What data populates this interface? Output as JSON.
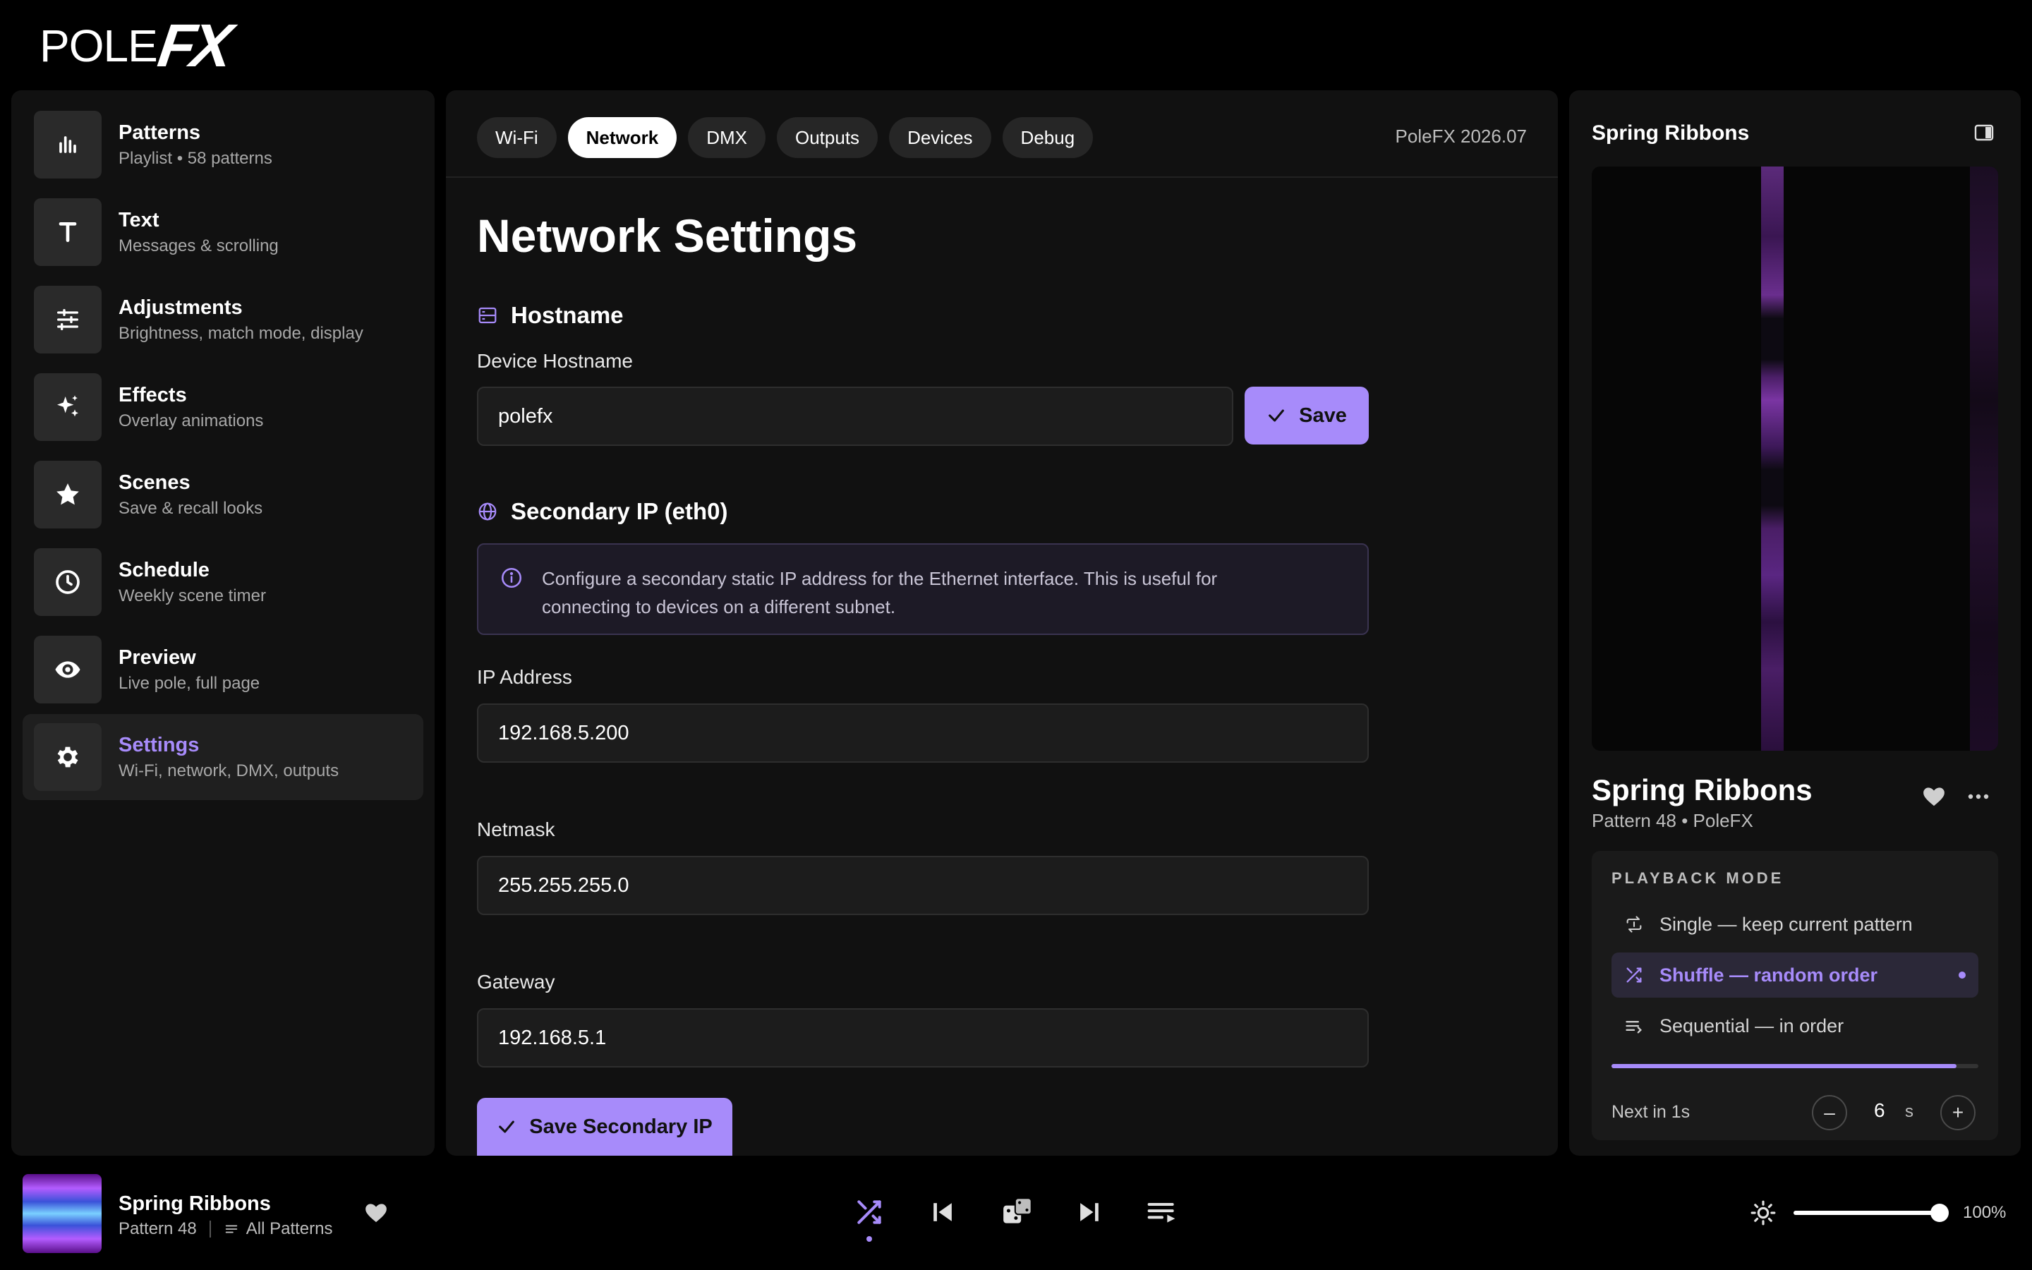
{
  "app": {
    "logo_text_a": "POLE",
    "logo_text_b": "FX"
  },
  "sidebar": {
    "items": [
      {
        "title": "Patterns",
        "subtitle": "Playlist • 58 patterns",
        "icon": "bars-icon"
      },
      {
        "title": "Text",
        "subtitle": "Messages & scrolling",
        "icon": "text-icon"
      },
      {
        "title": "Adjustments",
        "subtitle": "Brightness, match mode, display",
        "icon": "sliders-icon"
      },
      {
        "title": "Effects",
        "subtitle": "Overlay animations",
        "icon": "sparkles-icon"
      },
      {
        "title": "Scenes",
        "subtitle": "Save & recall looks",
        "icon": "star-icon"
      },
      {
        "title": "Schedule",
        "subtitle": "Weekly scene timer",
        "icon": "clock-icon"
      },
      {
        "title": "Preview",
        "subtitle": "Live pole, full page",
        "icon": "eye-icon"
      },
      {
        "title": "Settings",
        "subtitle": "Wi-Fi, network, DMX, outputs",
        "icon": "gear-icon",
        "active": true
      }
    ]
  },
  "main": {
    "tabs": [
      "Wi-Fi",
      "Network",
      "DMX",
      "Outputs",
      "Devices",
      "Debug"
    ],
    "active_tab": "Network",
    "version": "PoleFX 2026.07",
    "title": "Network Settings",
    "hostname": {
      "section": "Hostname",
      "label": "Device Hostname",
      "value": "polefx",
      "save_label": "Save"
    },
    "secondary": {
      "section": "Secondary IP (eth0)",
      "info_line1": "Configure a secondary static IP address for the Ethernet interface. This is useful for",
      "info_line2": "connecting to devices on a different subnet.",
      "ip_label": "IP Address",
      "ip_value": "192.168.5.200",
      "netmask_label": "Netmask",
      "netmask_value": "255.255.255.0",
      "gateway_label": "Gateway",
      "gateway_value": "192.168.5.1",
      "save_label": "Save Secondary IP"
    }
  },
  "right": {
    "header_title": "Spring Ribbons",
    "now_playing_title": "Spring Ribbons",
    "now_playing_sub": "Pattern 48 • PoleFX",
    "playback": {
      "heading": "PLAYBACK MODE",
      "options": [
        {
          "label": "Single — keep current pattern",
          "icon": "repeat-one-icon"
        },
        {
          "label": "Shuffle — random order",
          "icon": "shuffle-icon",
          "active": true
        },
        {
          "label": "Sequential — in order",
          "icon": "list-icon"
        }
      ],
      "progress": 0.94,
      "next_label": "Next in 1s",
      "minus_label": "–",
      "plus_label": "+",
      "interval_value": "6",
      "interval_unit": "s"
    }
  },
  "player": {
    "title": "Spring Ribbons",
    "pattern": "Pattern 48",
    "playlist": "All Patterns",
    "volume_pct": "100%",
    "volume_level": 1.0
  },
  "colors": {
    "accent": "#a78bfa",
    "panel": "#111111",
    "background": "#000000"
  }
}
